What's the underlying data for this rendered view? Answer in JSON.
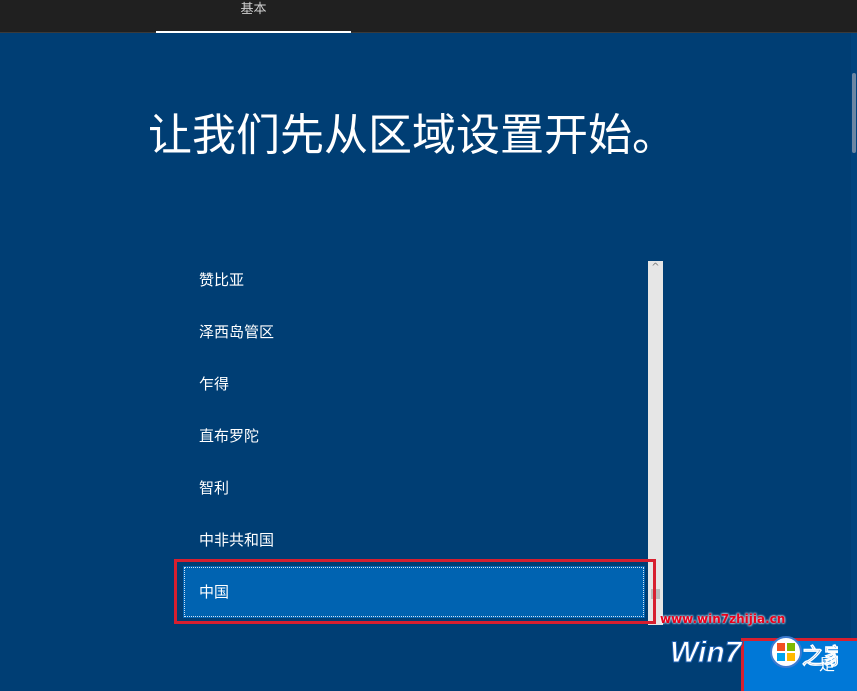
{
  "header": {
    "tab_label": "基本"
  },
  "main": {
    "heading": "让我们先从区域设置开始。"
  },
  "region_list": {
    "items": [
      {
        "label": "赞比亚",
        "selected": false
      },
      {
        "label": "泽西岛管区",
        "selected": false
      },
      {
        "label": "乍得",
        "selected": false
      },
      {
        "label": "直布罗陀",
        "selected": false
      },
      {
        "label": "智利",
        "selected": false
      },
      {
        "label": "中非共和国",
        "selected": false
      },
      {
        "label": "中国",
        "selected": true
      }
    ],
    "scroll_up_glyph": "^"
  },
  "footer": {
    "yes_label": "是"
  },
  "watermark": {
    "url": "www.win7zhijia.cn",
    "logo_text": "Win7",
    "logo_suffix": "之家"
  },
  "colors": {
    "background": "#003e74",
    "selected_item": "#0063b1",
    "button": "#0078d7",
    "highlight": "#d71f2f"
  }
}
